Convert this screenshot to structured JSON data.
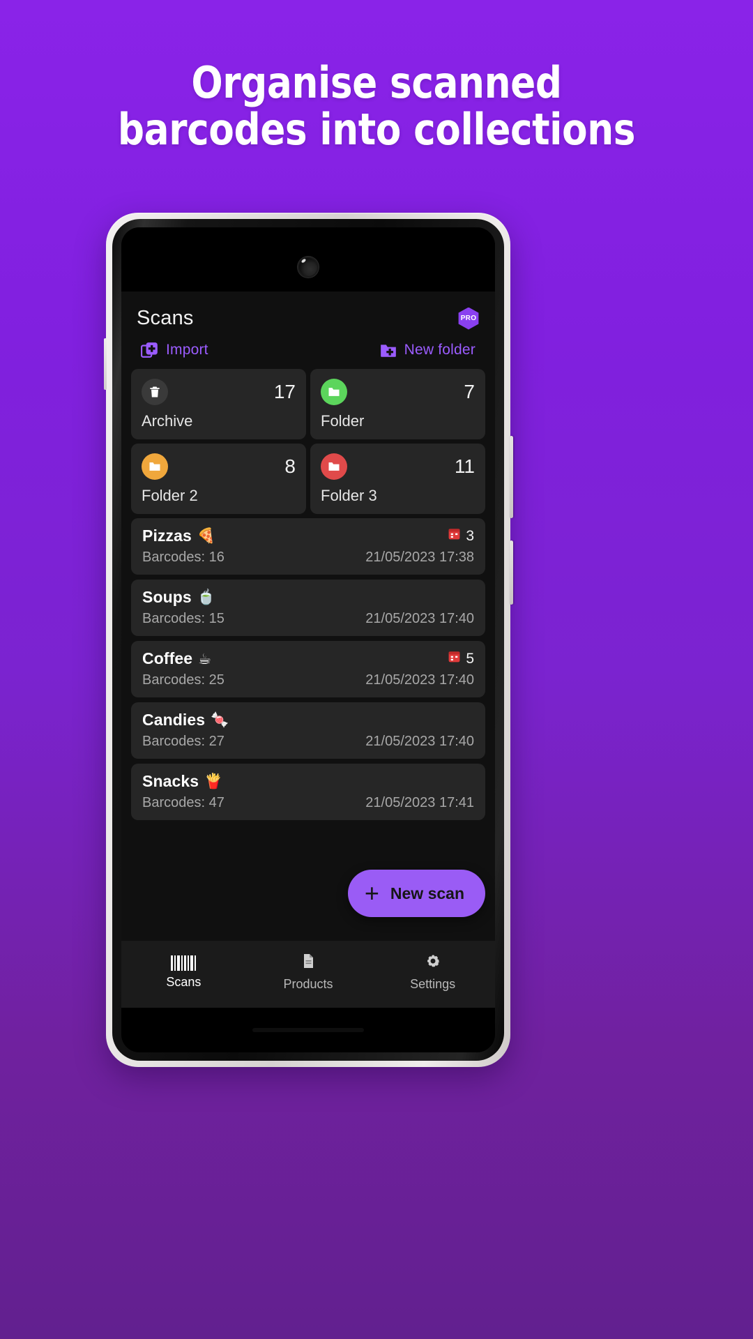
{
  "promo": {
    "headline_line1": "Organise scanned",
    "headline_line2": "barcodes into collections",
    "bg_top_color": "#8A23E8",
    "bg_bottom_color": "#62208F"
  },
  "app": {
    "title": "Scans",
    "pro_badge_label": "PRO",
    "accent_color": "#9B5CFF",
    "actions": {
      "import_label": "Import",
      "new_folder_label": "New folder"
    },
    "folders": [
      {
        "name": "Archive",
        "count": "17",
        "icon": "trash-icon",
        "icon_color": "#3a3a3a"
      },
      {
        "name": "Folder",
        "count": "7",
        "icon": "folder-icon",
        "icon_color": "#5CD55C"
      },
      {
        "name": "Folder 2",
        "count": "8",
        "icon": "folder-icon",
        "icon_color": "#F0A73C"
      },
      {
        "name": "Folder 3",
        "count": "11",
        "icon": "folder-icon",
        "icon_color": "#E04A4A"
      }
    ],
    "scans": [
      {
        "name": "Pizzas",
        "emoji": "🍕",
        "subtitle": "Barcodes: 16",
        "date": "21/05/2023 17:38",
        "alarm_count": "3"
      },
      {
        "name": "Soups",
        "emoji": "🍵",
        "subtitle": "Barcodes: 15",
        "date": "21/05/2023 17:40",
        "alarm_count": ""
      },
      {
        "name": "Coffee",
        "emoji": "☕",
        "subtitle": "Barcodes: 25",
        "date": "21/05/2023 17:40",
        "alarm_count": "5"
      },
      {
        "name": "Candies",
        "emoji": "🍬",
        "subtitle": "Barcodes: 27",
        "date": "21/05/2023 17:40",
        "alarm_count": ""
      },
      {
        "name": "Snacks",
        "emoji": "🍟",
        "subtitle": "Barcodes: 47",
        "date": "21/05/2023 17:41",
        "alarm_count": ""
      }
    ],
    "fab": {
      "label": "New scan",
      "plus": "+"
    },
    "bottom_nav": [
      {
        "label": "Scans",
        "icon": "barcode-icon",
        "active": true
      },
      {
        "label": "Products",
        "icon": "document-icon",
        "active": false
      },
      {
        "label": "Settings",
        "icon": "gear-icon",
        "active": false
      }
    ]
  }
}
